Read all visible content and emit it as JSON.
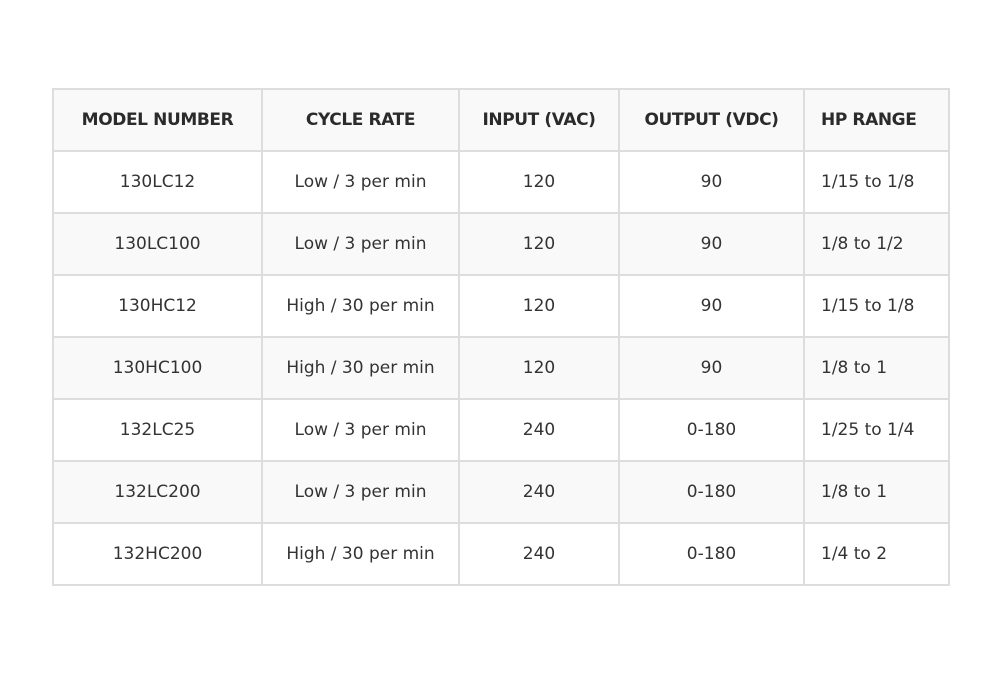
{
  "table": {
    "headers": [
      "MODEL NUMBER",
      "CYCLE RATE",
      "INPUT (VAC)",
      "OUTPUT (VDC)",
      "HP RANGE"
    ],
    "rows": [
      [
        "130LC12",
        "Low / 3 per min",
        "120",
        "90",
        "1/15 to 1/8"
      ],
      [
        "130LC100",
        "Low / 3 per min",
        "120",
        "90",
        "1/8 to 1/2"
      ],
      [
        "130HC12",
        "High / 30 per min",
        "120",
        "90",
        "1/15 to 1/8"
      ],
      [
        "130HC100",
        "High / 30 per min",
        "120",
        "90",
        "1/8 to 1"
      ],
      [
        "132LC25",
        "Low / 3 per min",
        "240",
        "0-180",
        "1/25 to 1/4"
      ],
      [
        "132LC200",
        "Low / 3 per min",
        "240",
        "0-180",
        "1/8 to 1"
      ],
      [
        "132HC200",
        "High / 30 per min",
        "240",
        "0-180",
        "1/4 to 2"
      ]
    ]
  },
  "colors": {
    "border": "#dddddd",
    "stripe": "#f9f9f9",
    "text": "#333333"
  }
}
